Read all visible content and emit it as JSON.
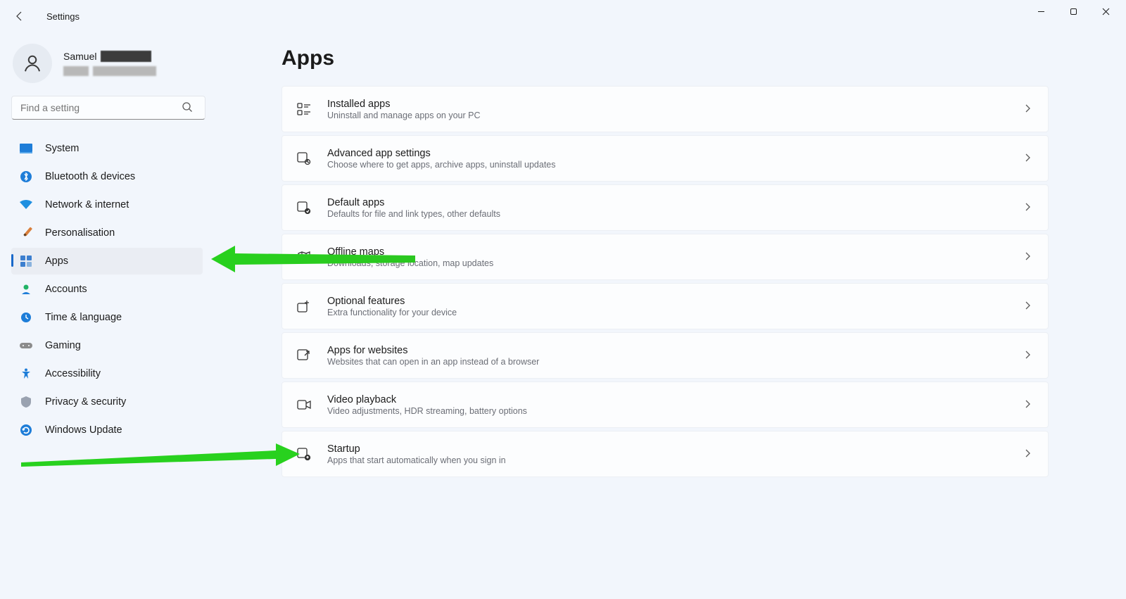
{
  "app": {
    "title": "Settings"
  },
  "user": {
    "first_name": "Samuel"
  },
  "search": {
    "placeholder": "Find a setting"
  },
  "nav": {
    "items": [
      {
        "id": "system",
        "label": "System"
      },
      {
        "id": "bluetooth",
        "label": "Bluetooth & devices"
      },
      {
        "id": "network",
        "label": "Network & internet"
      },
      {
        "id": "personalisation",
        "label": "Personalisation"
      },
      {
        "id": "apps",
        "label": "Apps"
      },
      {
        "id": "accounts",
        "label": "Accounts"
      },
      {
        "id": "time",
        "label": "Time & language"
      },
      {
        "id": "gaming",
        "label": "Gaming"
      },
      {
        "id": "accessibility",
        "label": "Accessibility"
      },
      {
        "id": "privacy",
        "label": "Privacy & security"
      },
      {
        "id": "update",
        "label": "Windows Update"
      }
    ],
    "active": "apps"
  },
  "page": {
    "title": "Apps",
    "cards": [
      {
        "id": "installed",
        "title": "Installed apps",
        "sub": "Uninstall and manage apps on your PC"
      },
      {
        "id": "advanced",
        "title": "Advanced app settings",
        "sub": "Choose where to get apps, archive apps, uninstall updates"
      },
      {
        "id": "default",
        "title": "Default apps",
        "sub": "Defaults for file and link types, other defaults"
      },
      {
        "id": "offline",
        "title": "Offline maps",
        "sub": "Downloads, storage location, map updates"
      },
      {
        "id": "optional",
        "title": "Optional features",
        "sub": "Extra functionality for your device"
      },
      {
        "id": "websites",
        "title": "Apps for websites",
        "sub": "Websites that can open in an app instead of a browser"
      },
      {
        "id": "video",
        "title": "Video playback",
        "sub": "Video adjustments, HDR streaming, battery options"
      },
      {
        "id": "startup",
        "title": "Startup",
        "sub": "Apps that start automatically when you sign in"
      }
    ]
  },
  "annotations": {
    "arrow1_target": "sidebar-item-apps",
    "arrow2_target": "card-startup"
  }
}
